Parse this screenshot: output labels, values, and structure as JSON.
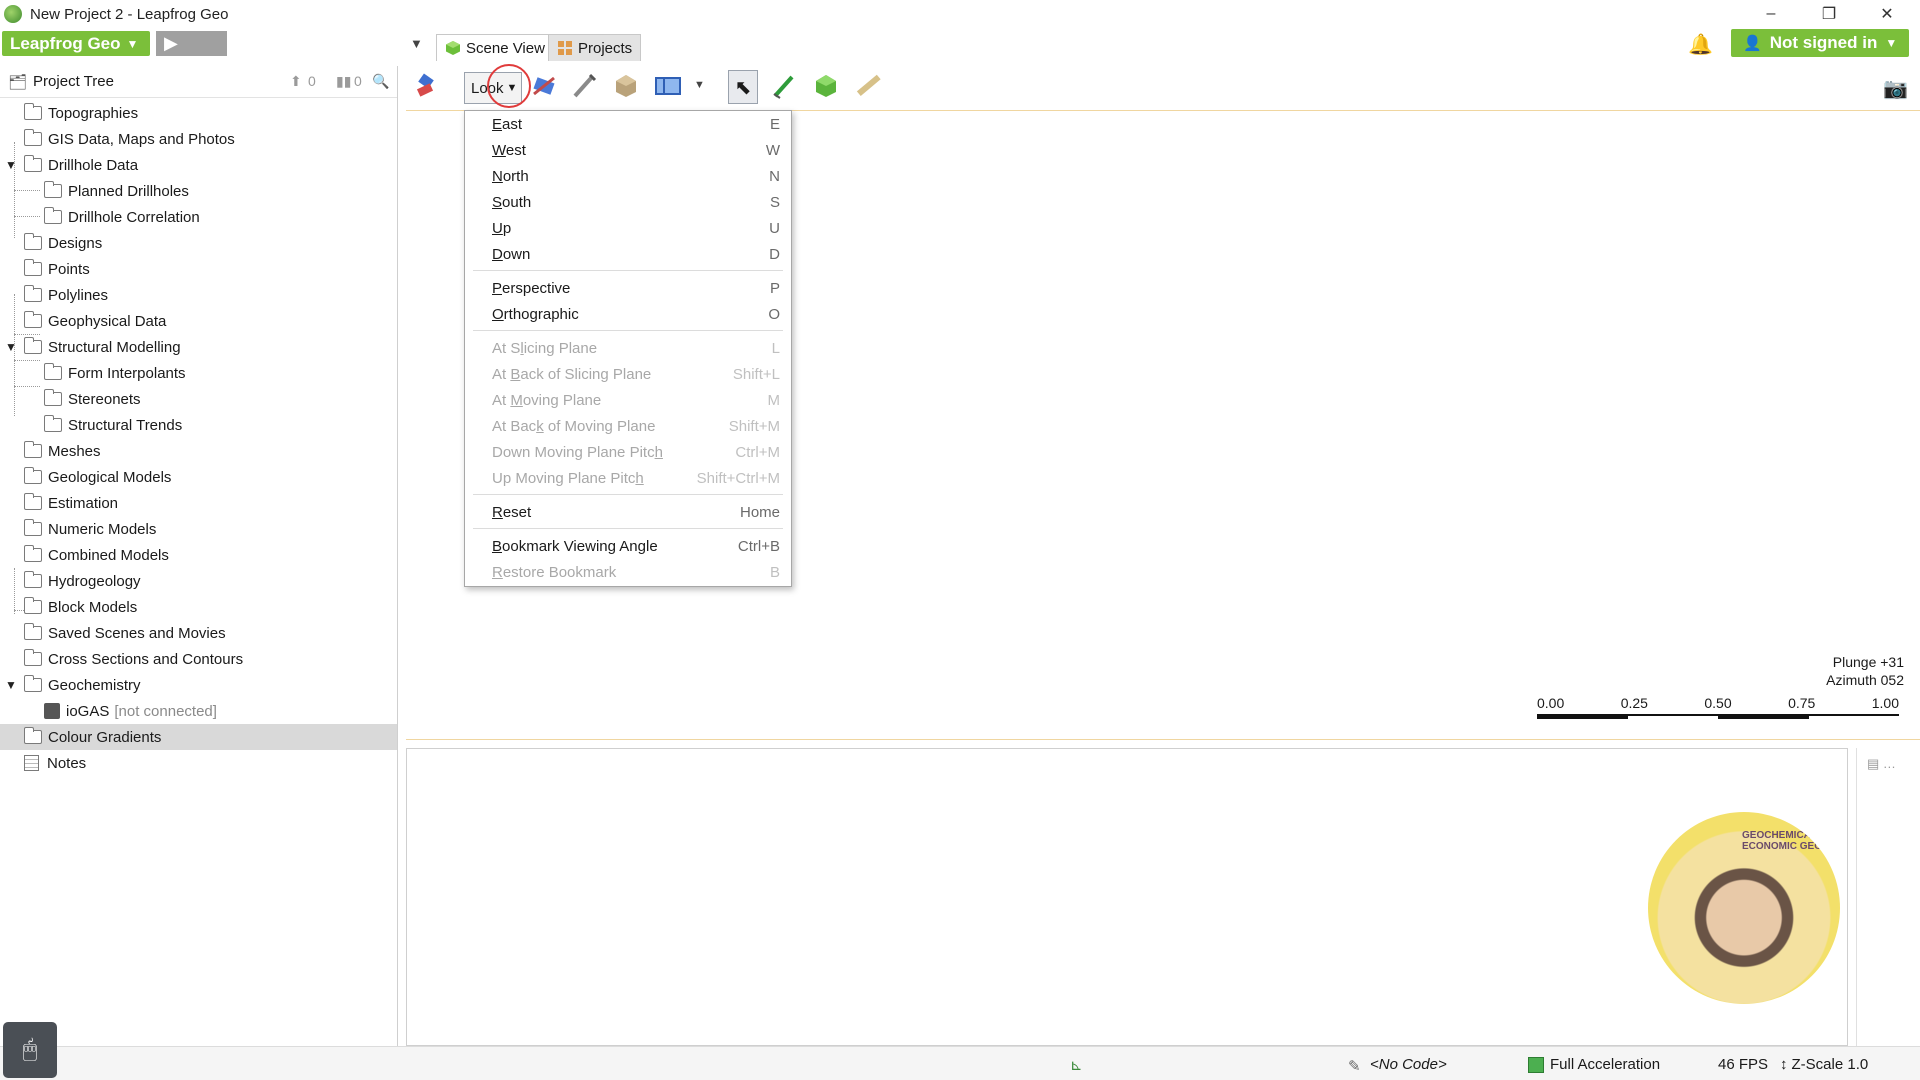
{
  "window": {
    "title": "New Project 2 - Leapfrog Geo",
    "minimize": "–",
    "restore": "❐",
    "close": "✕"
  },
  "header": {
    "app_menu_label": "Leapfrog Geo",
    "play_label": "▶",
    "tabs": [
      {
        "label": "Scene View",
        "active": true
      },
      {
        "label": "Projects",
        "active": false
      }
    ],
    "sign_in_label": "Not signed in",
    "bell_icon": "bell-icon"
  },
  "project_tree": {
    "title": "Project Tree",
    "up_count": "0",
    "bar_count": "0",
    "items": [
      {
        "label": "Topographies"
      },
      {
        "label": "GIS Data, Maps and Photos"
      },
      {
        "label": "Drillhole Data"
      },
      {
        "label": "Planned Drillholes"
      },
      {
        "label": "Drillhole Correlation"
      },
      {
        "label": "Designs"
      },
      {
        "label": "Points"
      },
      {
        "label": "Polylines"
      },
      {
        "label": "Geophysical Data"
      },
      {
        "label": "Structural Modelling"
      },
      {
        "label": "Form Interpolants"
      },
      {
        "label": "Stereonets"
      },
      {
        "label": "Structural Trends"
      },
      {
        "label": "Meshes"
      },
      {
        "label": "Geological Models"
      },
      {
        "label": "Estimation"
      },
      {
        "label": "Numeric Models"
      },
      {
        "label": "Combined Models"
      },
      {
        "label": "Hydrogeology"
      },
      {
        "label": "Block Models"
      },
      {
        "label": "Saved Scenes and Movies"
      },
      {
        "label": "Cross Sections and Contours"
      },
      {
        "label": "Geochemistry"
      },
      {
        "label": "ioGAS",
        "suffix": "[not connected]"
      },
      {
        "label": "Colour Gradients"
      },
      {
        "label": "Notes"
      }
    ]
  },
  "toolbar": {
    "look_label": "Look"
  },
  "look_menu": {
    "items": [
      {
        "prefix": "",
        "accel": "E",
        "rest": "ast",
        "shortcut": "E",
        "enabled": true
      },
      {
        "prefix": "",
        "accel": "W",
        "rest": "est",
        "shortcut": "W",
        "enabled": true
      },
      {
        "prefix": "",
        "accel": "N",
        "rest": "orth",
        "shortcut": "N",
        "enabled": true
      },
      {
        "prefix": "",
        "accel": "S",
        "rest": "outh",
        "shortcut": "S",
        "enabled": true
      },
      {
        "prefix": "",
        "accel": "U",
        "rest": "p",
        "shortcut": "U",
        "enabled": true
      },
      {
        "prefix": "",
        "accel": "D",
        "rest": "own",
        "shortcut": "D",
        "enabled": true
      },
      {
        "prefix": "",
        "accel": "P",
        "rest": "erspective",
        "shortcut": "P",
        "enabled": true
      },
      {
        "prefix": "",
        "accel": "O",
        "rest": "rthographic",
        "shortcut": "O",
        "enabled": true
      },
      {
        "prefix": "At S",
        "accel": "l",
        "rest": "icing Plane",
        "shortcut": "L",
        "enabled": false
      },
      {
        "prefix": "At ",
        "accel": "B",
        "rest": "ack of Slicing Plane",
        "shortcut": "Shift+L",
        "enabled": false
      },
      {
        "prefix": "At ",
        "accel": "M",
        "rest": "oving Plane",
        "shortcut": "M",
        "enabled": false
      },
      {
        "prefix": "At Bac",
        "accel": "k",
        "rest": " of Moving Plane",
        "shortcut": "Shift+M",
        "enabled": false
      },
      {
        "prefix": "Down Moving Plane Pitc",
        "accel": "h",
        "rest": "",
        "shortcut": "Ctrl+M",
        "enabled": false
      },
      {
        "prefix": "Up Moving Plane Pitc",
        "accel": "h",
        "rest": "",
        "shortcut": "Shift+Ctrl+M",
        "enabled": false
      },
      {
        "prefix": "",
        "accel": "R",
        "rest": "eset",
        "shortcut": "Home",
        "enabled": true
      },
      {
        "prefix": "",
        "accel": "B",
        "rest": "ookmark Viewing Angle",
        "shortcut": "Ctrl+B",
        "enabled": true
      },
      {
        "prefix": "",
        "accel": "R",
        "rest": "estore Bookmark",
        "shortcut": "B",
        "enabled": false
      }
    ]
  },
  "scene": {
    "plunge": "Plunge +31",
    "azimuth": "Azimuth 052",
    "scale_labels": [
      "0.00",
      "0.25",
      "0.50",
      "0.75",
      "1.00"
    ]
  },
  "webcam_overlay": {
    "label": "GEOCHEMICAL ECONOMIC GEO"
  },
  "status_bar": {
    "code": "<No Code>",
    "acceleration": "Full Acceleration",
    "fps": "46 FPS",
    "zscale": "Z-Scale 1.0"
  },
  "colors": {
    "brand_green": "#7bbf3a",
    "selected_row": "#d9d9d9",
    "scene_border": "#f0d6a0"
  }
}
